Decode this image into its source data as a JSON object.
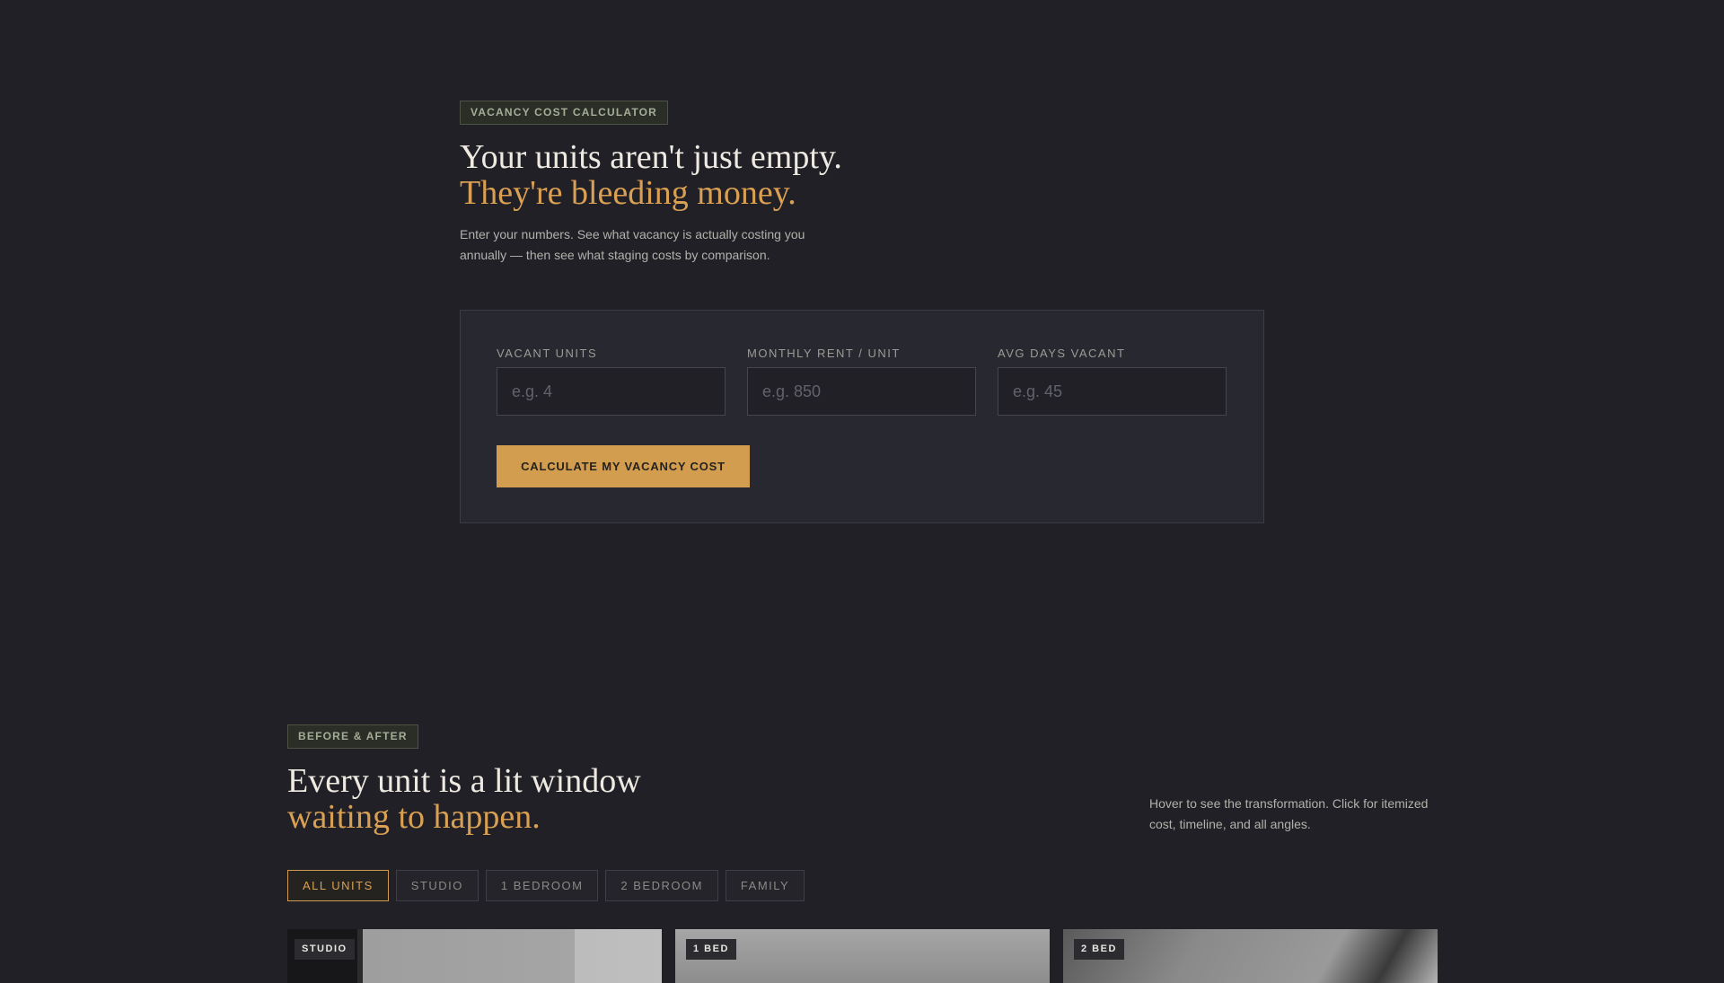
{
  "calculator": {
    "tag": "VACANCY COST CALCULATOR",
    "headline_line1": "Your units aren't just empty.",
    "headline_line2": "They're bleeding money.",
    "description": "Enter your numbers. See what vacancy is actually costing you annually — then see what staging costs by comparison.",
    "fields": [
      {
        "label": "VACANT UNITS",
        "placeholder": "e.g. 4",
        "value": ""
      },
      {
        "label": "MONTHLY RENT / UNIT",
        "placeholder": "e.g. 850",
        "value": ""
      },
      {
        "label": "AVG DAYS VACANT",
        "placeholder": "e.g. 45",
        "value": ""
      }
    ],
    "button_label": "CALCULATE MY VACANCY COST"
  },
  "gallery": {
    "tag": "BEFORE & AFTER",
    "headline_line1": "Every unit is a lit window",
    "headline_line2": "waiting to happen.",
    "hint": "Hover to see the transformation. Click for itemized cost, timeline, and all angles.",
    "filters": [
      {
        "label": "ALL UNITS",
        "active": true
      },
      {
        "label": "STUDIO",
        "active": false
      },
      {
        "label": "1 BEDROOM",
        "active": false
      },
      {
        "label": "2 BEDROOM",
        "active": false
      },
      {
        "label": "FAMILY",
        "active": false
      }
    ],
    "cards": [
      {
        "badge": "STUDIO"
      },
      {
        "badge": "1 BED"
      },
      {
        "badge": "2 BED"
      }
    ]
  },
  "colors": {
    "background": "#202026",
    "accent": "#d29d4f",
    "card_background": "#282830",
    "tag_text": "#a6ad97"
  }
}
